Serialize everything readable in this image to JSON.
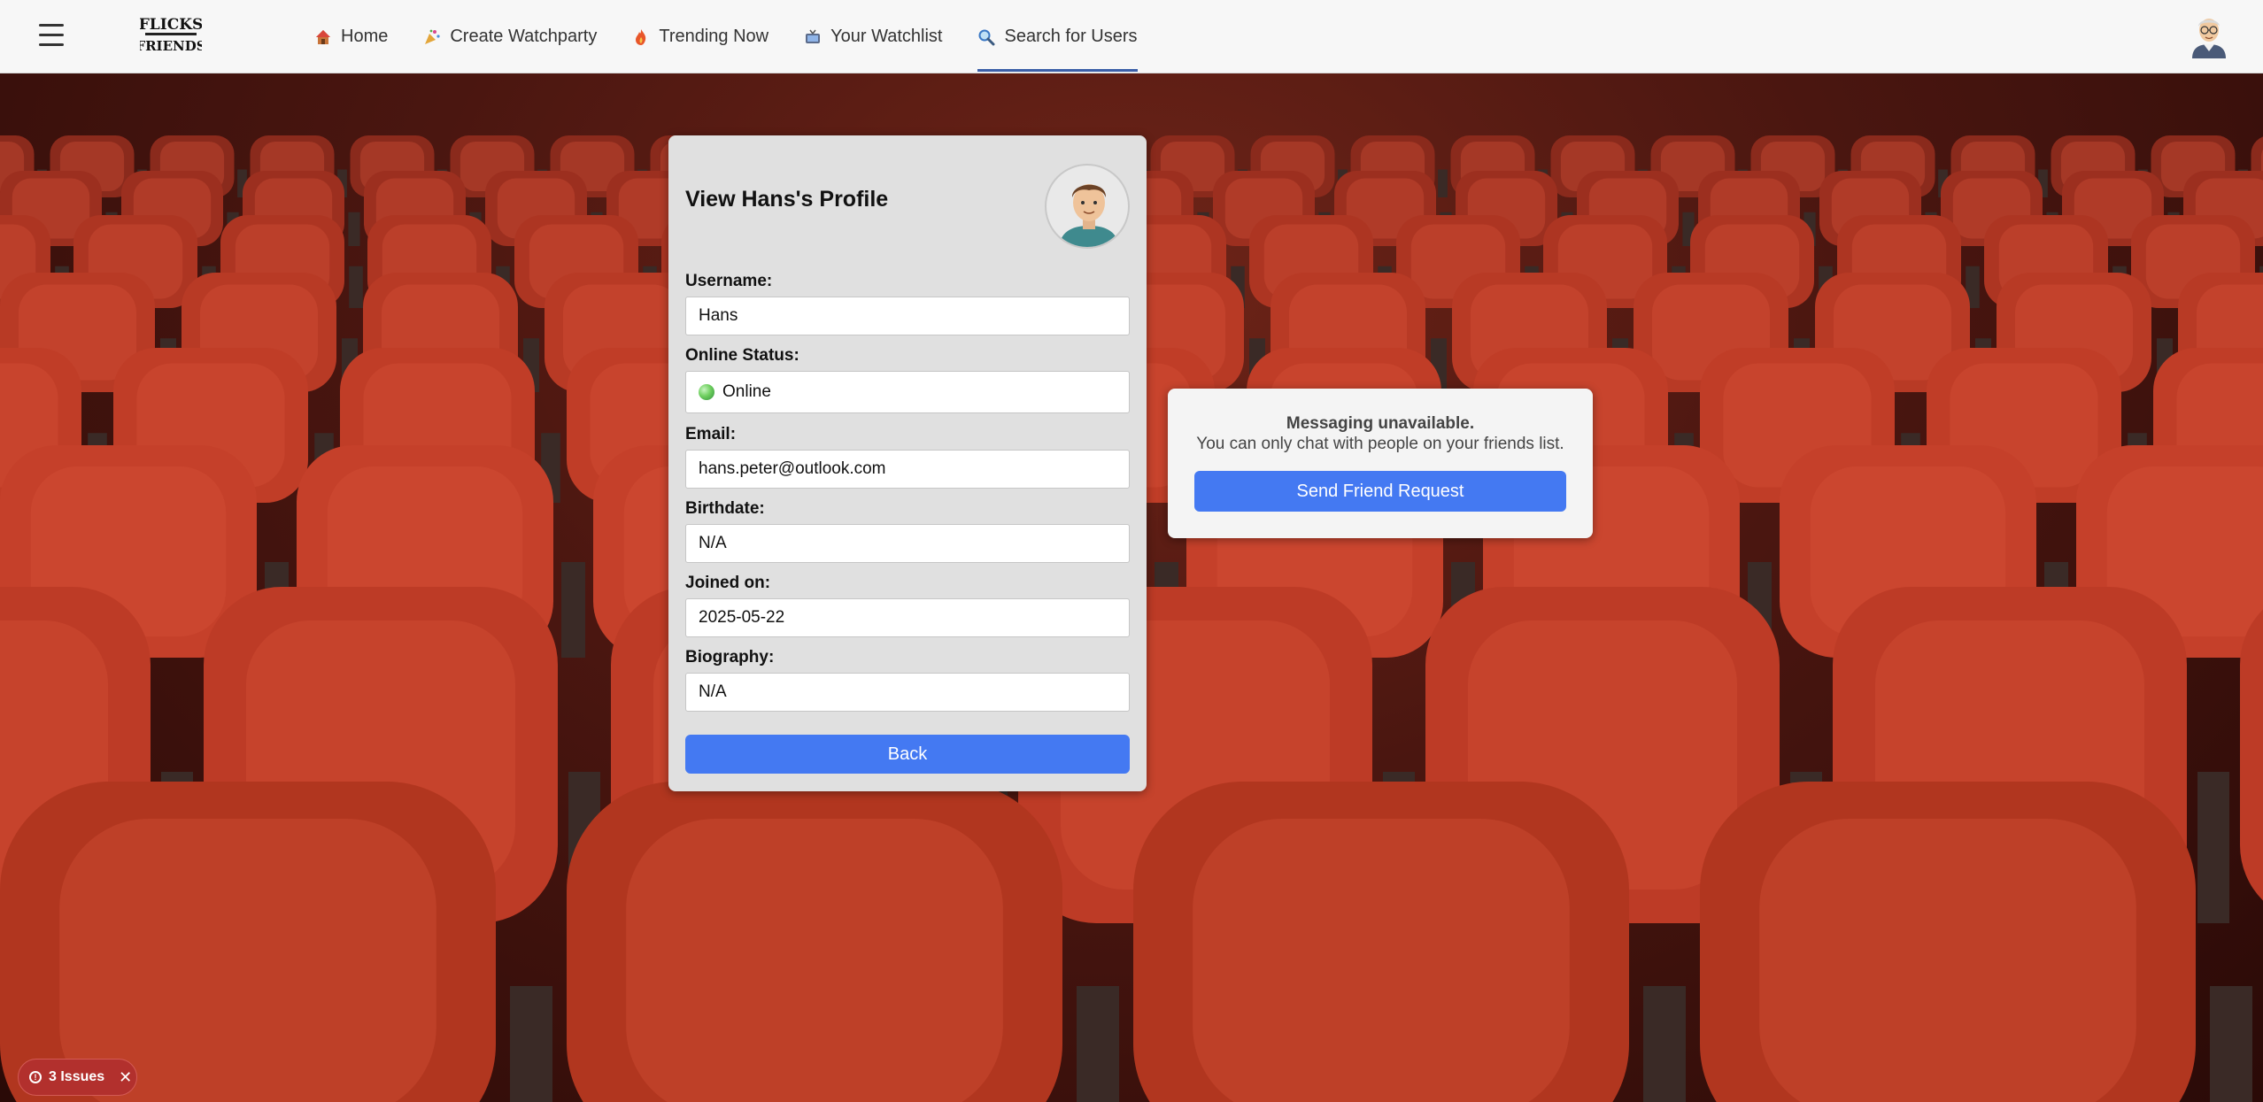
{
  "nav": {
    "logo_text_top": "FLICKS",
    "logo_text_bottom": "FRIENDS",
    "links": [
      {
        "label": "Home",
        "icon": "house-icon"
      },
      {
        "label": "Create Watchparty",
        "icon": "party-popper-icon"
      },
      {
        "label": "Trending Now",
        "icon": "fire-icon"
      },
      {
        "label": "Your Watchlist",
        "icon": "tv-icon"
      },
      {
        "label": "Search for Users",
        "icon": "magnifier-icon",
        "active": true
      }
    ]
  },
  "profile": {
    "title": "View Hans's Profile",
    "fields": {
      "username": {
        "label": "Username:",
        "value": "Hans"
      },
      "status": {
        "label": "Online Status:",
        "value": "Online"
      },
      "email": {
        "label": "Email:",
        "value": "hans.peter@outlook.com"
      },
      "birthdate": {
        "label": "Birthdate:",
        "value": "N/A"
      },
      "joined": {
        "label": "Joined on:",
        "value": "2025-05-22"
      },
      "biography": {
        "label": "Biography:",
        "value": "N/A"
      }
    },
    "back_label": "Back"
  },
  "messaging": {
    "title": "Messaging unavailable.",
    "subtitle": "You can only chat with people on your friends list.",
    "button_label": "Send Friend Request"
  },
  "issues": {
    "label": "3 Issues"
  },
  "colors": {
    "primary_button": "#4479f2",
    "active_tab_underline": "#3b5fa8",
    "issues_badge": "#b2302d",
    "card_background": "#e0e0e0"
  }
}
